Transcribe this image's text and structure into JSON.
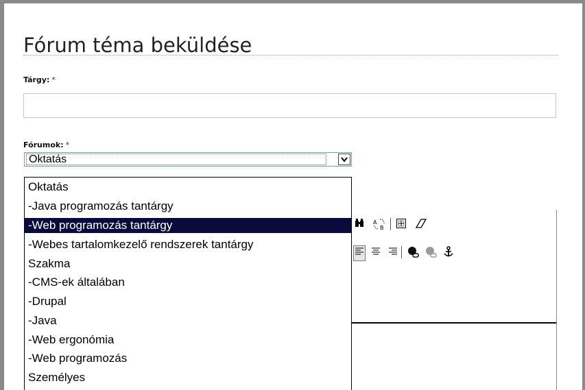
{
  "page": {
    "title": "Fórum téma beküldése"
  },
  "subject": {
    "label": "Tárgy:",
    "required_mark": "*",
    "value": ""
  },
  "forums": {
    "label": "Fórumok:",
    "required_mark": "*",
    "selected_value": "Oktatás",
    "options": [
      "Oktatás",
      "-Java programozás tantárgy",
      "-Web programozás tantárgy",
      "-Webes tartalomkezelő rendszerek tantárgy",
      "Szakma",
      "-CMS-ek általában",
      "-Drupal",
      "-Java",
      "-Web ergonómia",
      "-Web programozás",
      "Személyes"
    ],
    "highlighted_option": "-Web programozás tantárgy"
  },
  "editor_toolbar": {
    "row1_icons": [
      "find-icon",
      "replace-icon",
      "table-icon",
      "eraser-icon"
    ],
    "row2_icons": [
      "align-left-icon",
      "align-center-icon",
      "align-right-icon",
      "link-icon",
      "unlink-icon",
      "anchor-icon"
    ]
  },
  "colors": {
    "highlight": "#0a0a3c",
    "frame": "#8a8a8a"
  }
}
